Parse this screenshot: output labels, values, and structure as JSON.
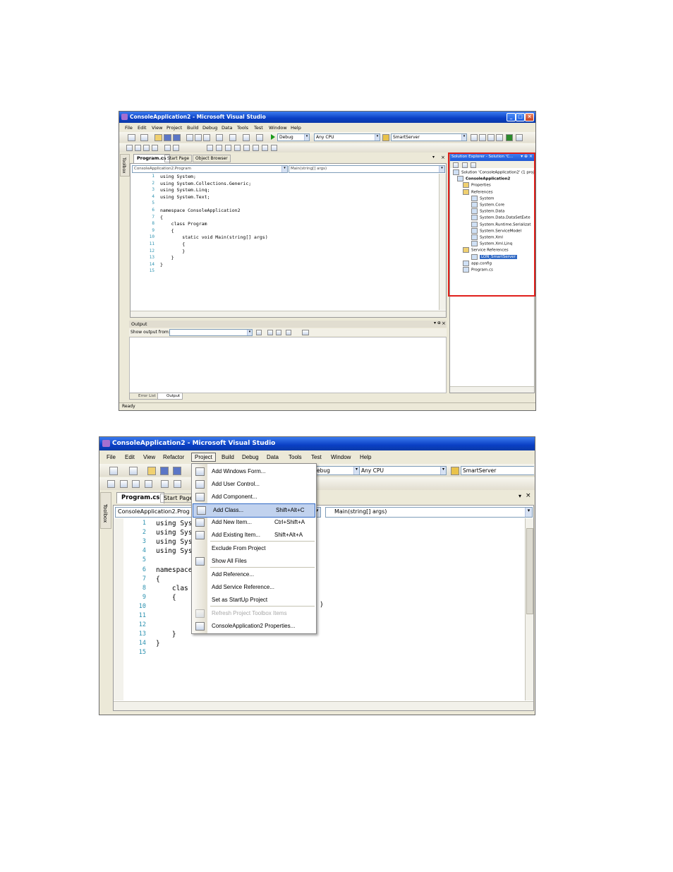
{
  "app": {
    "title": "ConsoleApplication2 - Microsoft Visual Studio",
    "status": "Ready"
  },
  "shot1": {
    "menus": [
      "File",
      "Edit",
      "View",
      "Project",
      "Build",
      "Debug",
      "Data",
      "Tools",
      "Test",
      "Window",
      "Help"
    ],
    "toolbar": {
      "config": "Debug",
      "platform": "Any CPU",
      "server": "SmartServer"
    },
    "tabs": [
      "Program.cs",
      "Start Page",
      "Object Browser"
    ],
    "toolbox_label": "Toolbox",
    "nav": {
      "left": "ConsoleApplication2.Program",
      "right": "Main(string[] args)"
    },
    "code_lines": [
      {
        "n": "1",
        "t": "using System;"
      },
      {
        "n": "2",
        "t": "using System.Collections.Generic;"
      },
      {
        "n": "3",
        "t": "using System.Linq;"
      },
      {
        "n": "4",
        "t": "using System.Text;"
      },
      {
        "n": "5",
        "t": ""
      },
      {
        "n": "6",
        "t": "namespace ConsoleApplication2"
      },
      {
        "n": "7",
        "t": "{"
      },
      {
        "n": "8",
        "t": "    class Program"
      },
      {
        "n": "9",
        "t": "    {"
      },
      {
        "n": "10",
        "t": "        static void Main(string[] args)"
      },
      {
        "n": "11",
        "t": "        {"
      },
      {
        "n": "12",
        "t": "        }"
      },
      {
        "n": "13",
        "t": "    }"
      },
      {
        "n": "14",
        "t": "}"
      },
      {
        "n": "15",
        "t": ""
      }
    ],
    "output": {
      "title": "Output",
      "show_from": "Show output from:",
      "tabs": [
        "Error List",
        "Output"
      ]
    },
    "solution_explorer": {
      "title": "Solution Explorer - Solution 'C...",
      "items": [
        "Solution 'ConsoleApplication2' (1 proje",
        "ConsoleApplication2",
        "Properties",
        "References",
        "System",
        "System.Core",
        "System.Data",
        "System.Data.DataSetExte",
        "System.Runtime.Serializat",
        "System.ServiceModel",
        "System.Xml",
        "System.Xml.Linq",
        "Service References",
        "LON_SmartServer",
        "app.config",
        "Program.cs"
      ]
    },
    "highlight_color": "#e0201b"
  },
  "shot2": {
    "menus": [
      "File",
      "Edit",
      "View",
      "Refactor",
      "Project",
      "Build",
      "Debug",
      "Data",
      "Tools",
      "Test",
      "Window",
      "Help"
    ],
    "toolbar": {
      "config": "ebug",
      "platform": "Any CPU",
      "server": "SmartServer"
    },
    "tabs": [
      "Program.cs",
      "Start Page"
    ],
    "toolbox_label": "Toolbox",
    "nav": {
      "left": "ConsoleApplication2.Prog",
      "right": "Main(string[] args)"
    },
    "code_lines": [
      {
        "n": "1",
        "t": "using Sys"
      },
      {
        "n": "2",
        "t": "using Sys"
      },
      {
        "n": "3",
        "t": "using Sys"
      },
      {
        "n": "4",
        "t": "using Sys"
      },
      {
        "n": "5",
        "t": ""
      },
      {
        "n": "6",
        "t": "namespace"
      },
      {
        "n": "7",
        "t": "{"
      },
      {
        "n": "8",
        "t": "    clas"
      },
      {
        "n": "9",
        "t": "    {"
      },
      {
        "n": "10",
        "t": ""
      },
      {
        "n": "11",
        "t": ""
      },
      {
        "n": "12",
        "t": ""
      },
      {
        "n": "13",
        "t": "    }"
      },
      {
        "n": "14",
        "t": "}"
      },
      {
        "n": "15",
        "t": ""
      }
    ],
    "line10_tail": ")",
    "project_menu": [
      {
        "label": "Add Windows Form...",
        "shortcut": ""
      },
      {
        "label": "Add User Control...",
        "shortcut": ""
      },
      {
        "label": "Add Component...",
        "shortcut": ""
      },
      {
        "label": "Add Class...",
        "shortcut": "Shift+Alt+C"
      },
      {
        "label": "Add New Item...",
        "shortcut": "Ctrl+Shift+A"
      },
      {
        "label": "Add Existing Item...",
        "shortcut": "Shift+Alt+A"
      },
      {
        "label": "Exclude From Project",
        "shortcut": ""
      },
      {
        "label": "Show All Files",
        "shortcut": ""
      },
      {
        "label": "Add Reference...",
        "shortcut": ""
      },
      {
        "label": "Add Service Reference...",
        "shortcut": ""
      },
      {
        "label": "Set as StartUp Project",
        "shortcut": ""
      },
      {
        "label": "Refresh Project Toolbox Items",
        "shortcut": ""
      },
      {
        "label": "ConsoleApplication2 Properties...",
        "shortcut": ""
      }
    ]
  }
}
